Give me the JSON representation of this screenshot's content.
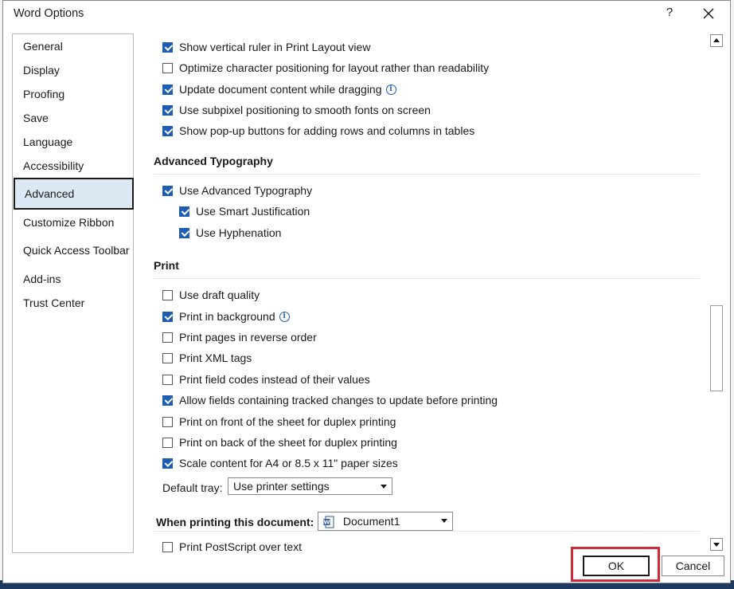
{
  "window": {
    "title": "Word Options",
    "help_label": "?"
  },
  "nav": {
    "items": [
      {
        "label": "General",
        "selected": false
      },
      {
        "label": "Display",
        "selected": false
      },
      {
        "label": "Proofing",
        "selected": false
      },
      {
        "label": "Save",
        "selected": false
      },
      {
        "label": "Language",
        "selected": false
      },
      {
        "label": "Accessibility",
        "selected": false
      },
      {
        "label": "Advanced",
        "selected": true
      },
      {
        "label": "Customize Ribbon",
        "selected": false
      },
      {
        "label": "Quick Access Toolbar",
        "selected": false
      },
      {
        "label": "Add-ins",
        "selected": false
      },
      {
        "label": "Trust Center",
        "selected": false
      }
    ]
  },
  "display_options": [
    {
      "label": "Show vertical ruler in Print Layout view",
      "checked": true
    },
    {
      "label": "Optimize character positioning for layout rather than readability",
      "checked": false
    },
    {
      "label": "Update document content while dragging",
      "checked": true,
      "info": true
    },
    {
      "label": "Use subpixel positioning to smooth fonts on screen",
      "checked": true
    },
    {
      "label": "Show pop-up buttons for adding rows and columns in tables",
      "checked": true
    }
  ],
  "typography": {
    "heading": "Advanced Typography",
    "options": [
      {
        "label": "Use Advanced Typography",
        "checked": true
      },
      {
        "label": "Use Smart Justification",
        "checked": true
      },
      {
        "label": "Use Hyphenation",
        "checked": true
      }
    ]
  },
  "print": {
    "heading": "Print",
    "options": [
      {
        "label": "Use draft quality",
        "checked": false
      },
      {
        "label": "Print in background",
        "checked": true,
        "info": true
      },
      {
        "label": "Print pages in reverse order",
        "checked": false
      },
      {
        "label": "Print XML tags",
        "checked": false
      },
      {
        "label": "Print field codes instead of their values",
        "checked": false
      },
      {
        "label": "Allow fields containing tracked changes to update before printing",
        "checked": true
      },
      {
        "label": "Print on front of the sheet for duplex printing",
        "checked": false
      },
      {
        "label": "Print on back of the sheet for duplex printing",
        "checked": false
      },
      {
        "label": "Scale content for A4 or 8.5 x 11\" paper sizes",
        "checked": true
      }
    ],
    "default_tray_label": "Default tray:",
    "default_tray_value": "Use printer settings"
  },
  "when_printing": {
    "label": "When printing this document:",
    "document_value": "Document1",
    "options": [
      {
        "label": "Print PostScript over text",
        "checked": false
      }
    ]
  },
  "buttons": {
    "ok": "OK",
    "cancel": "Cancel"
  },
  "colors": {
    "accent": "#1e5db3",
    "highlight": "#d02a3a",
    "selected_nav": "#dde8f5"
  },
  "icons": {
    "info": "info-icon",
    "close": "close-icon",
    "word_document": "word-document-icon"
  }
}
